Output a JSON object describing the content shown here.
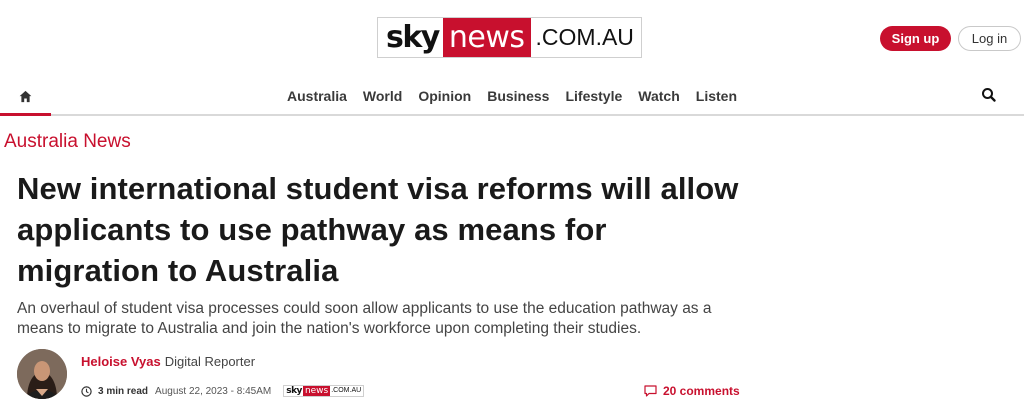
{
  "header": {
    "logo": {
      "sky": "sky",
      "news": "news",
      "domain": ".COM.AU"
    },
    "signup_label": "Sign up",
    "login_label": "Log in"
  },
  "nav": {
    "home_icon": "home-icon",
    "items": [
      {
        "label": "Australia"
      },
      {
        "label": "World"
      },
      {
        "label": "Opinion"
      },
      {
        "label": "Business"
      },
      {
        "label": "Lifestyle"
      },
      {
        "label": "Watch"
      },
      {
        "label": "Listen"
      }
    ],
    "search_icon": "search-icon"
  },
  "article": {
    "section": "Australia News",
    "headline": "New international student visa reforms will allow applicants to use pathway as means for migration to Australia",
    "standfirst": "An overhaul of student visa processes could soon allow applicants to use the education pathway as a means to migrate to Australia and join the nation's workforce upon completing their studies.",
    "author": {
      "name": "Heloise Vyas",
      "role": "Digital Reporter"
    },
    "read_time": "3 min read",
    "date": "August 22, 2023 - 8:45AM",
    "source_logo": {
      "sky": "sky",
      "news": "news",
      "domain": ".COM.AU"
    },
    "comments": "20 comments"
  },
  "colors": {
    "brand_red": "#c8102e",
    "text": "#1a1a1a"
  }
}
